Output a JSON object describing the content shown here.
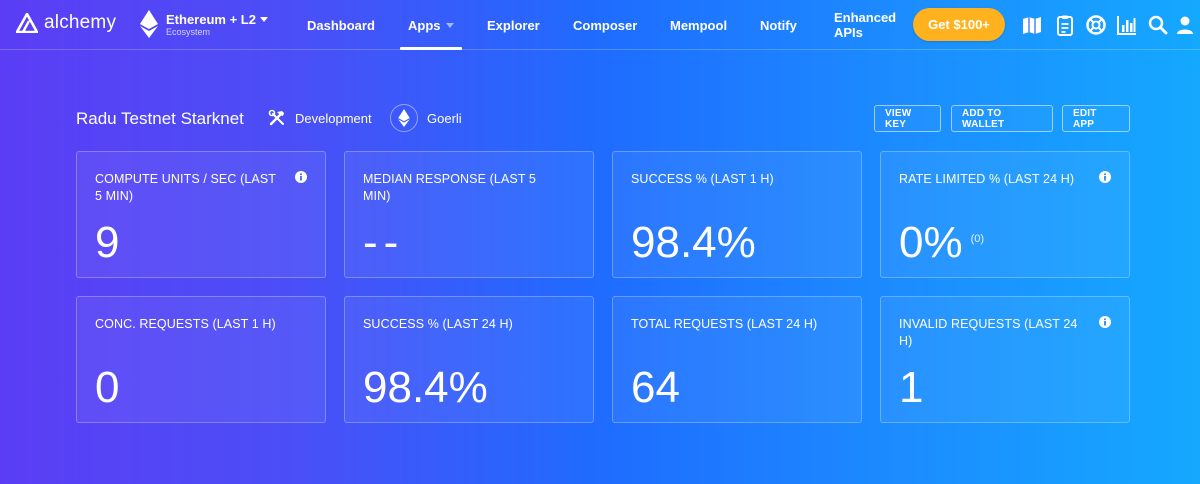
{
  "brand": {
    "name": "alchemy"
  },
  "ecosystem": {
    "title": "Ethereum + L2",
    "subtitle": "Ecosystem"
  },
  "nav": {
    "dashboard": "Dashboard",
    "apps": "Apps",
    "explorer": "Explorer",
    "composer": "Composer",
    "mempool": "Mempool",
    "notify": "Notify",
    "enhanced_line1": "Enhanced",
    "enhanced_line2": "APIs",
    "active": "Apps"
  },
  "cta": {
    "label": "Get $100+",
    "color": "#ffb21e"
  },
  "toolbar_icons": [
    "map-icon",
    "clipboard-icon",
    "support-icon",
    "analytics-icon",
    "search-icon",
    "user-icon"
  ],
  "app": {
    "name": "Radu Testnet Starknet",
    "environment": "Development",
    "network": "Goerli"
  },
  "actions": {
    "view_key": "VIEW KEY",
    "add_to_wallet": "ADD TO WALLET",
    "edit_app": "EDIT APP"
  },
  "metrics": [
    {
      "label": "COMPUTE UNITS / SEC (LAST 5 MIN)",
      "value": "9",
      "sub": "",
      "info": true
    },
    {
      "label": "MEDIAN RESPONSE (LAST 5 MIN)",
      "value": "--",
      "sub": "",
      "info": false
    },
    {
      "label": "SUCCESS % (LAST 1 H)",
      "value": "98.4%",
      "sub": "",
      "info": false
    },
    {
      "label": "RATE LIMITED % (LAST 24 H)",
      "value": "0%",
      "sub": "(0)",
      "info": true
    },
    {
      "label": "CONC. REQUESTS (LAST 1 H)",
      "value": "0",
      "sub": "",
      "info": false
    },
    {
      "label": "SUCCESS % (LAST 24 H)",
      "value": "98.4%",
      "sub": "",
      "info": false
    },
    {
      "label": "TOTAL REQUESTS (LAST 24 H)",
      "value": "64",
      "sub": "",
      "info": false
    },
    {
      "label": "INVALID REQUESTS (LAST 24 H)",
      "value": "1",
      "sub": "",
      "info": true
    }
  ],
  "colors": {
    "gradient_start": "#5b3df5",
    "gradient_mid": "#1f6cff",
    "gradient_end": "#14a8ff"
  }
}
